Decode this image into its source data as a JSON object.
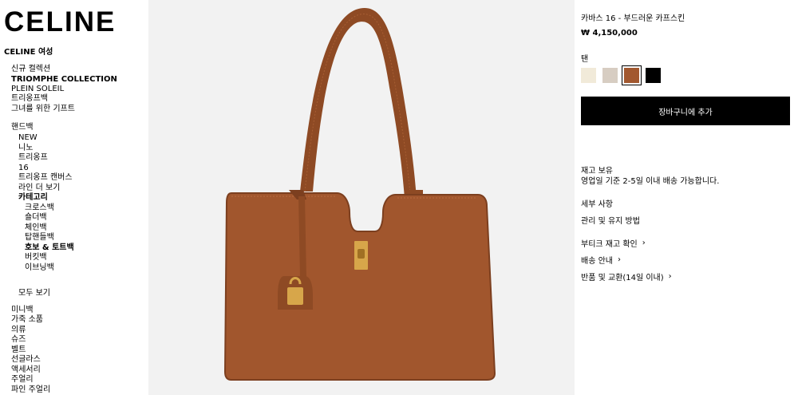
{
  "brand": {
    "logo_text": "CELINE"
  },
  "sidebar": {
    "section_title": "CELINE 여성",
    "top_items": [
      {
        "label": "신규 컬렉션",
        "bold": false
      },
      {
        "label": "TRIOMPHE COLLECTION",
        "bold": true
      },
      {
        "label": "PLEIN SOLEIL",
        "bold": false
      },
      {
        "label": "트리옹프백",
        "bold": false
      },
      {
        "label": "그녀를 위한 기프트",
        "bold": false
      }
    ],
    "handbags": {
      "title": "핸드백",
      "items": [
        {
          "label": "NEW"
        },
        {
          "label": "니노"
        },
        {
          "label": "트리옹프"
        },
        {
          "label": "16"
        },
        {
          "label": "트리옹프 캔버스"
        },
        {
          "label": "라인 더 보기"
        }
      ],
      "category_title": "카테고리",
      "categories": [
        {
          "label": "크로스백",
          "bold": false
        },
        {
          "label": "숄더백",
          "bold": false
        },
        {
          "label": "체인백",
          "bold": false
        },
        {
          "label": "탑핸들백",
          "bold": false
        },
        {
          "label": "호보 & 토트백",
          "bold": true
        },
        {
          "label": "버킷백",
          "bold": false
        },
        {
          "label": "이브닝백",
          "bold": false
        }
      ],
      "view_all": "모두 보기"
    },
    "bottom_items": [
      {
        "label": "미니백"
      },
      {
        "label": "가죽 소품"
      },
      {
        "label": "의류"
      },
      {
        "label": "슈즈"
      },
      {
        "label": "벨트"
      },
      {
        "label": "선글라스"
      },
      {
        "label": "액세서리"
      },
      {
        "label": "주얼리"
      },
      {
        "label": "파인 주얼리"
      }
    ]
  },
  "product": {
    "name": "카바스 16 - 부드러운 카프스킨",
    "price": "₩ 4,150,000",
    "color_label": "탠",
    "swatches": [
      {
        "name": "ivory",
        "color": "#f1ead9",
        "selected": false
      },
      {
        "name": "light-taupe",
        "color": "#d7cdc2",
        "selected": false
      },
      {
        "name": "tan",
        "color": "#a2582f",
        "selected": true
      },
      {
        "name": "black",
        "color": "#000000",
        "selected": false
      }
    ],
    "add_to_cart": "장바구니에 추가",
    "stock_status": "재고 보유",
    "shipping_note": "영업일 기준 2-5일 이내 배송 가능합니다.",
    "details": "세부 사항",
    "care": "관리 및 유지 방법",
    "links": [
      {
        "label": "부티크 재고 확인",
        "icon": "chevron-right-icon"
      },
      {
        "label": "배송 안내",
        "icon": "chevron-right-icon"
      },
      {
        "label": "반품 및 교환(14일 이내)",
        "icon": "chevron-right-icon"
      }
    ]
  },
  "colors": {
    "bag_main": "#a1562d",
    "bag_dark": "#7c3f1f",
    "hardware_gold": "#d7a64a",
    "image_background": "#f2f2f2",
    "button_bg": "#000000"
  }
}
